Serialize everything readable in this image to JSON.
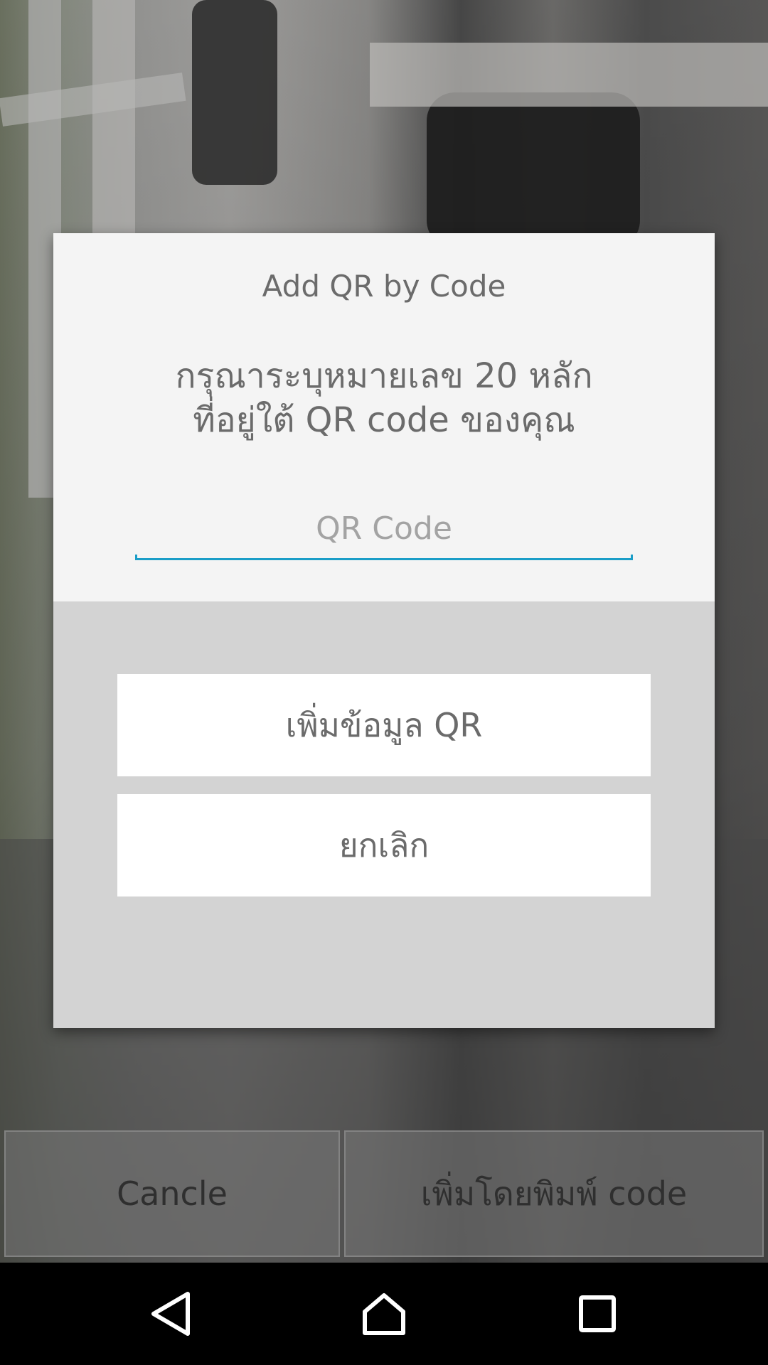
{
  "dialog": {
    "title": "Add QR by Code",
    "message_line1": "กรุณาระบุหมายเลข 20 หลัก",
    "message_line2": "ที่อยู่ใต้ QR code ของคุณ",
    "input": {
      "placeholder": "QR Code",
      "value": ""
    },
    "add_button_label": "เพิ่มข้อมูล QR",
    "cancel_button_label": "ยกเลิก"
  },
  "action_bar": {
    "cancel_label": "Cancle",
    "type_code_label": "เพิ่มโดยพิมพ์ code"
  },
  "nav_bar": {
    "back_icon": "back-triangle-icon",
    "home_icon": "home-icon",
    "recents_icon": "recents-square-icon"
  },
  "colors": {
    "dialog_top_bg": "#f4f4f4",
    "dialog_bottom_bg": "#d3d3d3",
    "input_underline": "#1a9dc7",
    "text_gray": "#6b6b6b",
    "nav_bar_bg": "#000000"
  }
}
